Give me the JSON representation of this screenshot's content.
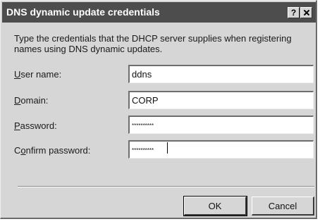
{
  "window": {
    "title": "DNS dynamic update credentials",
    "help_glyph": "?",
    "close_icon": "close-icon"
  },
  "description": "Type the credentials that the DHCP server supplies when registering names using DNS dynamic updates.",
  "fields": {
    "user_name": {
      "label_accel": "U",
      "label_rest": "ser name:",
      "value": "ddns"
    },
    "domain": {
      "label_accel": "D",
      "label_rest": "omain:",
      "value": "CORP"
    },
    "password": {
      "label_accel": "P",
      "label_rest": "assword:",
      "value": "**********"
    },
    "confirm_password": {
      "label_pre": "C",
      "label_accel": "o",
      "label_rest": "nfirm password:",
      "value": "**********"
    }
  },
  "buttons": {
    "ok": "OK",
    "cancel": "Cancel"
  },
  "colors": {
    "titlebar": "#4d4d4d",
    "dialog_bg": "#d6d6d6"
  }
}
